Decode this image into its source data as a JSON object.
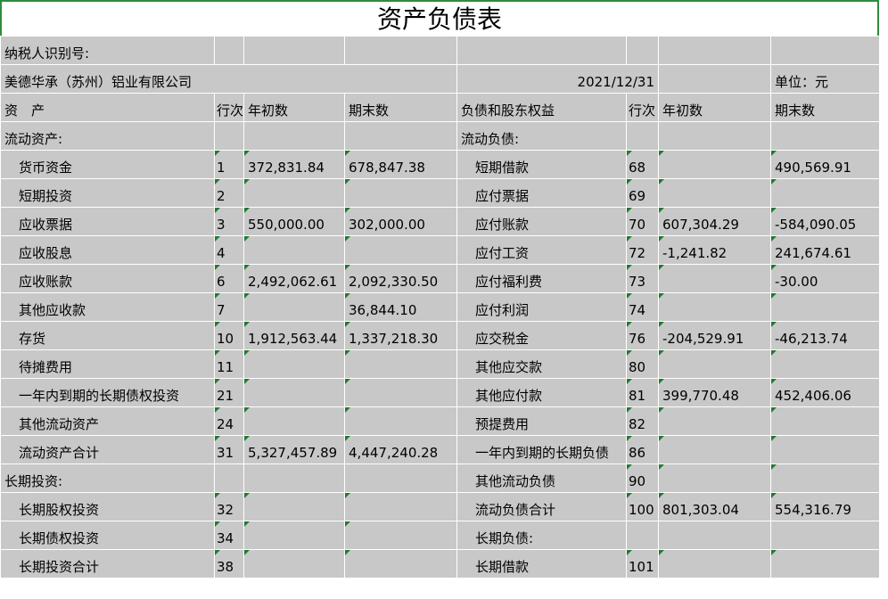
{
  "title": "资产负债表",
  "taxpayer_label": "纳税人识别号:",
  "company": "美德华承（苏州）铝业有限公司",
  "date": "2021/12/31",
  "unit": "单位：元",
  "headers": [
    "资　产",
    "行次",
    "年初数",
    "期末数",
    "负债和股东权益",
    "行次",
    "年初数",
    "期末数"
  ],
  "rows": [
    {
      "a": "流动资产:",
      "an": "",
      "ab": "",
      "ae": "",
      "l": "流动负债:",
      "ln": "",
      "lb": "",
      "le": ""
    },
    {
      "a": "货币资金",
      "an": "1",
      "ab": "372,831.84",
      "ae": "678,847.38",
      "l": "短期借款",
      "ln": "68",
      "lb": "",
      "le": "490,569.91"
    },
    {
      "a": "短期投资",
      "an": "2",
      "ab": "",
      "ae": "",
      "l": "应付票据",
      "ln": "69",
      "lb": "",
      "le": ""
    },
    {
      "a": "应收票据",
      "an": "3",
      "ab": "550,000.00",
      "ae": "302,000.00",
      "l": "应付账款",
      "ln": "70",
      "lb": "607,304.29",
      "le": "-584,090.05"
    },
    {
      "a": "应收股息",
      "an": "4",
      "ab": "",
      "ae": "",
      "l": "应付工资",
      "ln": "72",
      "lb": "-1,241.82",
      "le": "241,674.61"
    },
    {
      "a": "应收账款",
      "an": "6",
      "ab": "2,492,062.61",
      "ae": "2,092,330.50",
      "l": "应付福利费",
      "ln": "73",
      "lb": "",
      "le": "-30.00"
    },
    {
      "a": "其他应收款",
      "an": "7",
      "ab": "",
      "ae": "36,844.10",
      "l": "应付利润",
      "ln": "74",
      "lb": "",
      "le": ""
    },
    {
      "a": "存货",
      "an": "10",
      "ab": "1,912,563.44",
      "ae": "1,337,218.30",
      "l": "应交税金",
      "ln": "76",
      "lb": "-204,529.91",
      "le": "-46,213.74"
    },
    {
      "a": "待摊费用",
      "an": "11",
      "ab": "",
      "ae": "",
      "l": "其他应交款",
      "ln": "80",
      "lb": "",
      "le": ""
    },
    {
      "a": "一年内到期的长期债权投资",
      "an": "21",
      "ab": "",
      "ae": "",
      "l": "其他应付款",
      "ln": "81",
      "lb": "399,770.48",
      "le": "452,406.06"
    },
    {
      "a": "其他流动资产",
      "an": "24",
      "ab": "",
      "ae": "",
      "l": "预提费用",
      "ln": "82",
      "lb": "",
      "le": ""
    },
    {
      "a": "流动资产合计",
      "an": "31",
      "ab": "5,327,457.89",
      "ae": "4,447,240.28",
      "l": "一年内到期的长期负债",
      "ln": "86",
      "lb": "",
      "le": ""
    },
    {
      "a": "长期投资:",
      "an": "",
      "ab": "",
      "ae": "",
      "l": "其他流动负债",
      "ln": "90",
      "lb": "",
      "le": ""
    },
    {
      "a": "长期股权投资",
      "an": "32",
      "ab": "",
      "ae": "",
      "l": "流动负债合计",
      "ln": "100",
      "lb": "801,303.04",
      "le": "554,316.79"
    },
    {
      "a": "长期债权投资",
      "an": "34",
      "ab": "",
      "ae": "",
      "l": "长期负债:",
      "ln": "",
      "lb": "",
      "le": ""
    },
    {
      "a": "长期投资合计",
      "an": "38",
      "ab": "",
      "ae": "",
      "l": "长期借款",
      "ln": "101",
      "lb": "",
      "le": ""
    }
  ]
}
